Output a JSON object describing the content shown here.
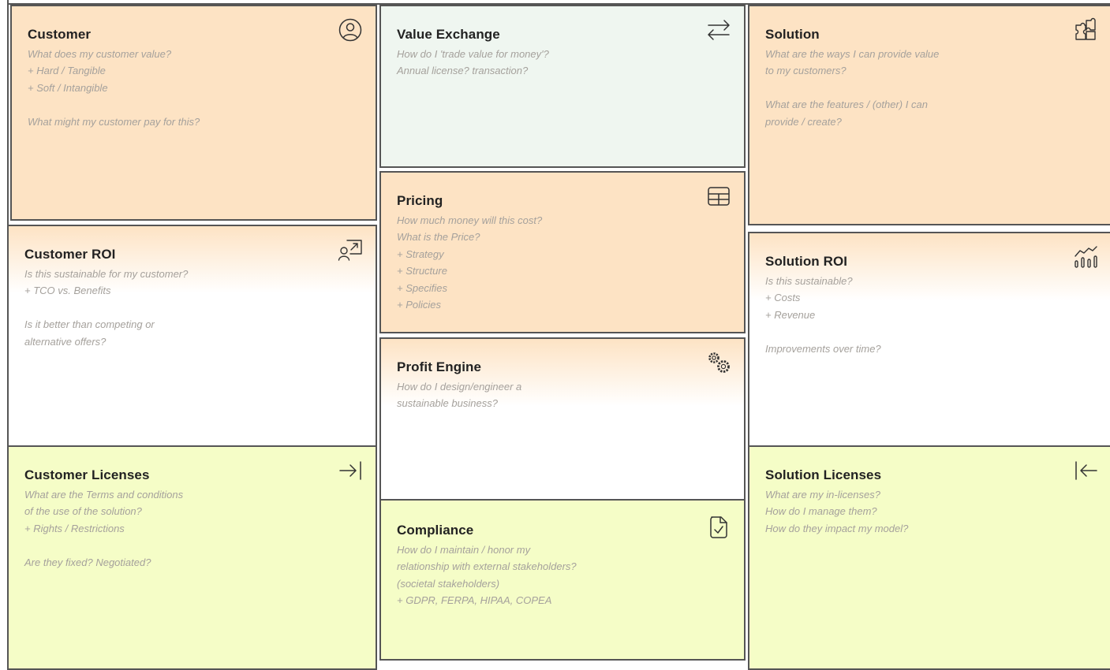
{
  "cards": {
    "customer": {
      "title": "Customer",
      "lines": [
        "What does my customer value?",
        "+ Hard / Tangible",
        "+ Soft / Intangible",
        "",
        "What might my customer pay for this?"
      ]
    },
    "value_exchange": {
      "title": "Value Exchange",
      "lines": [
        "How do I 'trade value for money'?",
        "Annual license? transaction?"
      ]
    },
    "solution": {
      "title": "Solution",
      "lines": [
        "What are the ways I can provide value",
        "to my customers?",
        "",
        "What are the features / (other) I can",
        "provide / create?"
      ]
    },
    "pricing": {
      "title": "Pricing",
      "lines": [
        "How much money will this cost?",
        "What is the Price?",
        "+ Strategy",
        "+ Structure",
        "+ Specifies",
        "+ Policies"
      ]
    },
    "customer_roi": {
      "title": "Customer ROI",
      "lines": [
        "Is this sustainable for my customer?",
        "+ TCO vs. Benefits",
        "",
        "Is it better than competing or",
        "alternative offers?"
      ]
    },
    "solution_roi": {
      "title": "Solution ROI",
      "lines": [
        "Is this sustainable?",
        "+ Costs",
        "+ Revenue",
        "",
        "Improvements over time?"
      ]
    },
    "profit_engine": {
      "title": "Profit Engine",
      "lines": [
        "How do I design/engineer a",
        "sustainable business?"
      ]
    },
    "customer_licenses": {
      "title": "Customer Licenses",
      "lines": [
        "What are the Terms and conditions",
        "of the use of the solution?",
        "+ Rights / Restrictions",
        "",
        "Are they fixed? Negotiated?"
      ]
    },
    "compliance": {
      "title": "Compliance",
      "lines": [
        "How do I maintain / honor my",
        "relationship with external stakeholders?",
        "(societal stakeholders)",
        "+ GDPR, FERPA, HIPAA, COPEA"
      ]
    },
    "solution_licenses": {
      "title": "Solution Licenses",
      "lines": [
        "What are my in-licenses?",
        "How do I manage them?",
        "How do they impact my model?"
      ]
    }
  },
  "icons": {
    "customer": "user-circle-icon",
    "value_exchange": "arrows-exchange-icon",
    "solution": "puzzle-icon",
    "pricing": "table-icon",
    "customer_roi": "user-trend-icon",
    "solution_roi": "chart-trend-icon",
    "profit_engine": "gears-icon",
    "customer_licenses": "arrow-right-bar-icon",
    "compliance": "file-check-icon",
    "solution_licenses": "arrow-left-bar-icon"
  },
  "colors": {
    "orange": "#fde3c4",
    "mint": "#eff6f0",
    "green": "#f5fdc7",
    "border": "#555555",
    "title": "#222222",
    "prompt": "#a5a19c"
  }
}
